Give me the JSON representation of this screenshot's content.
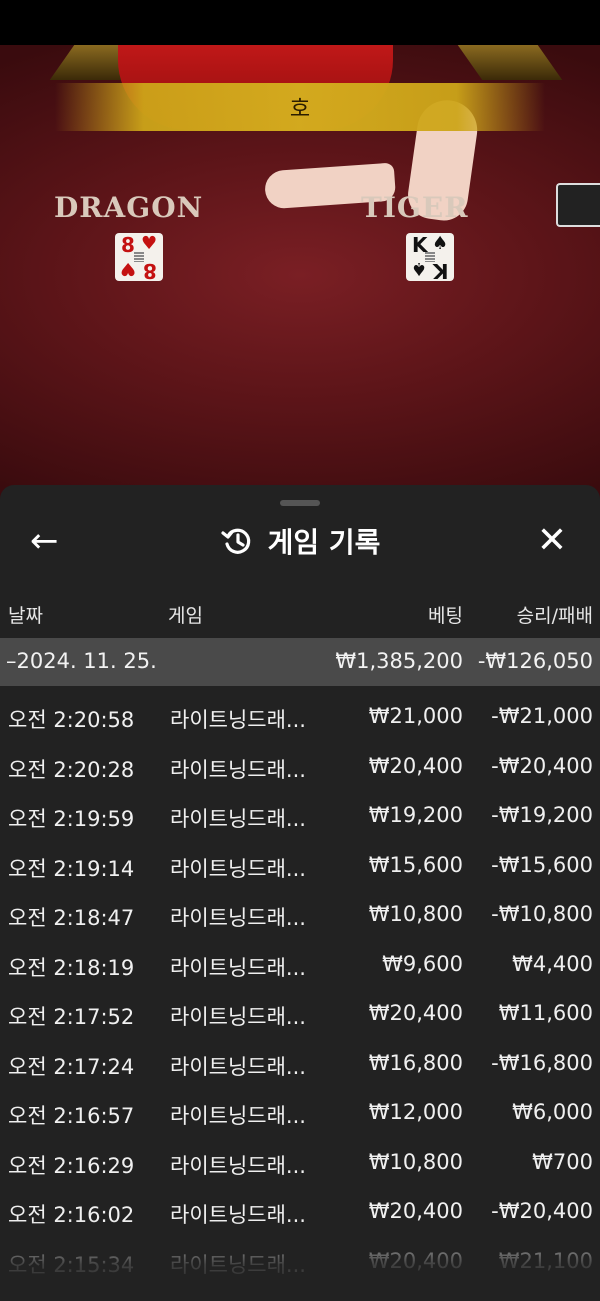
{
  "game_view": {
    "result_text": "호",
    "dragon_label": "DRAGON",
    "tiger_label": "TIGER",
    "dragon_card": {
      "rank": "8",
      "suit": "♥"
    },
    "tiger_card": {
      "rank": "K",
      "suit": "♠"
    }
  },
  "panel": {
    "title": "게임 기록",
    "back_icon": "←",
    "close_icon": "✕",
    "history_icon": "history-icon"
  },
  "columns": {
    "date": "날짜",
    "game": "게임",
    "bet": "베팅",
    "win_loss": "승리/패배"
  },
  "summary": {
    "date": "–2024. 11. 25.",
    "bet": "₩1,385,200",
    "win_loss": "-₩126,050"
  },
  "rows": [
    {
      "time": "오전 2:20:58",
      "game": "라이트닝드래...",
      "bet": "₩21,000",
      "win_loss": "-₩21,000"
    },
    {
      "time": "오전 2:20:28",
      "game": "라이트닝드래...",
      "bet": "₩20,400",
      "win_loss": "-₩20,400"
    },
    {
      "time": "오전 2:19:59",
      "game": "라이트닝드래...",
      "bet": "₩19,200",
      "win_loss": "-₩19,200"
    },
    {
      "time": "오전 2:19:14",
      "game": "라이트닝드래...",
      "bet": "₩15,600",
      "win_loss": "-₩15,600"
    },
    {
      "time": "오전 2:18:47",
      "game": "라이트닝드래...",
      "bet": "₩10,800",
      "win_loss": "-₩10,800"
    },
    {
      "time": "오전 2:18:19",
      "game": "라이트닝드래...",
      "bet": "₩9,600",
      "win_loss": "₩4,400"
    },
    {
      "time": "오전 2:17:52",
      "game": "라이트닝드래...",
      "bet": "₩20,400",
      "win_loss": "₩11,600"
    },
    {
      "time": "오전 2:17:24",
      "game": "라이트닝드래...",
      "bet": "₩16,800",
      "win_loss": "-₩16,800"
    },
    {
      "time": "오전 2:16:57",
      "game": "라이트닝드래...",
      "bet": "₩12,000",
      "win_loss": "₩6,000"
    },
    {
      "time": "오전 2:16:29",
      "game": "라이트닝드래...",
      "bet": "₩10,800",
      "win_loss": "₩700"
    },
    {
      "time": "오전 2:16:02",
      "game": "라이트닝드래...",
      "bet": "₩20,400",
      "win_loss": "-₩20,400"
    },
    {
      "time": "오전 2:15:34",
      "game": "라이트닝드래...",
      "bet": "₩20,400",
      "win_loss": "₩21,100"
    }
  ]
}
